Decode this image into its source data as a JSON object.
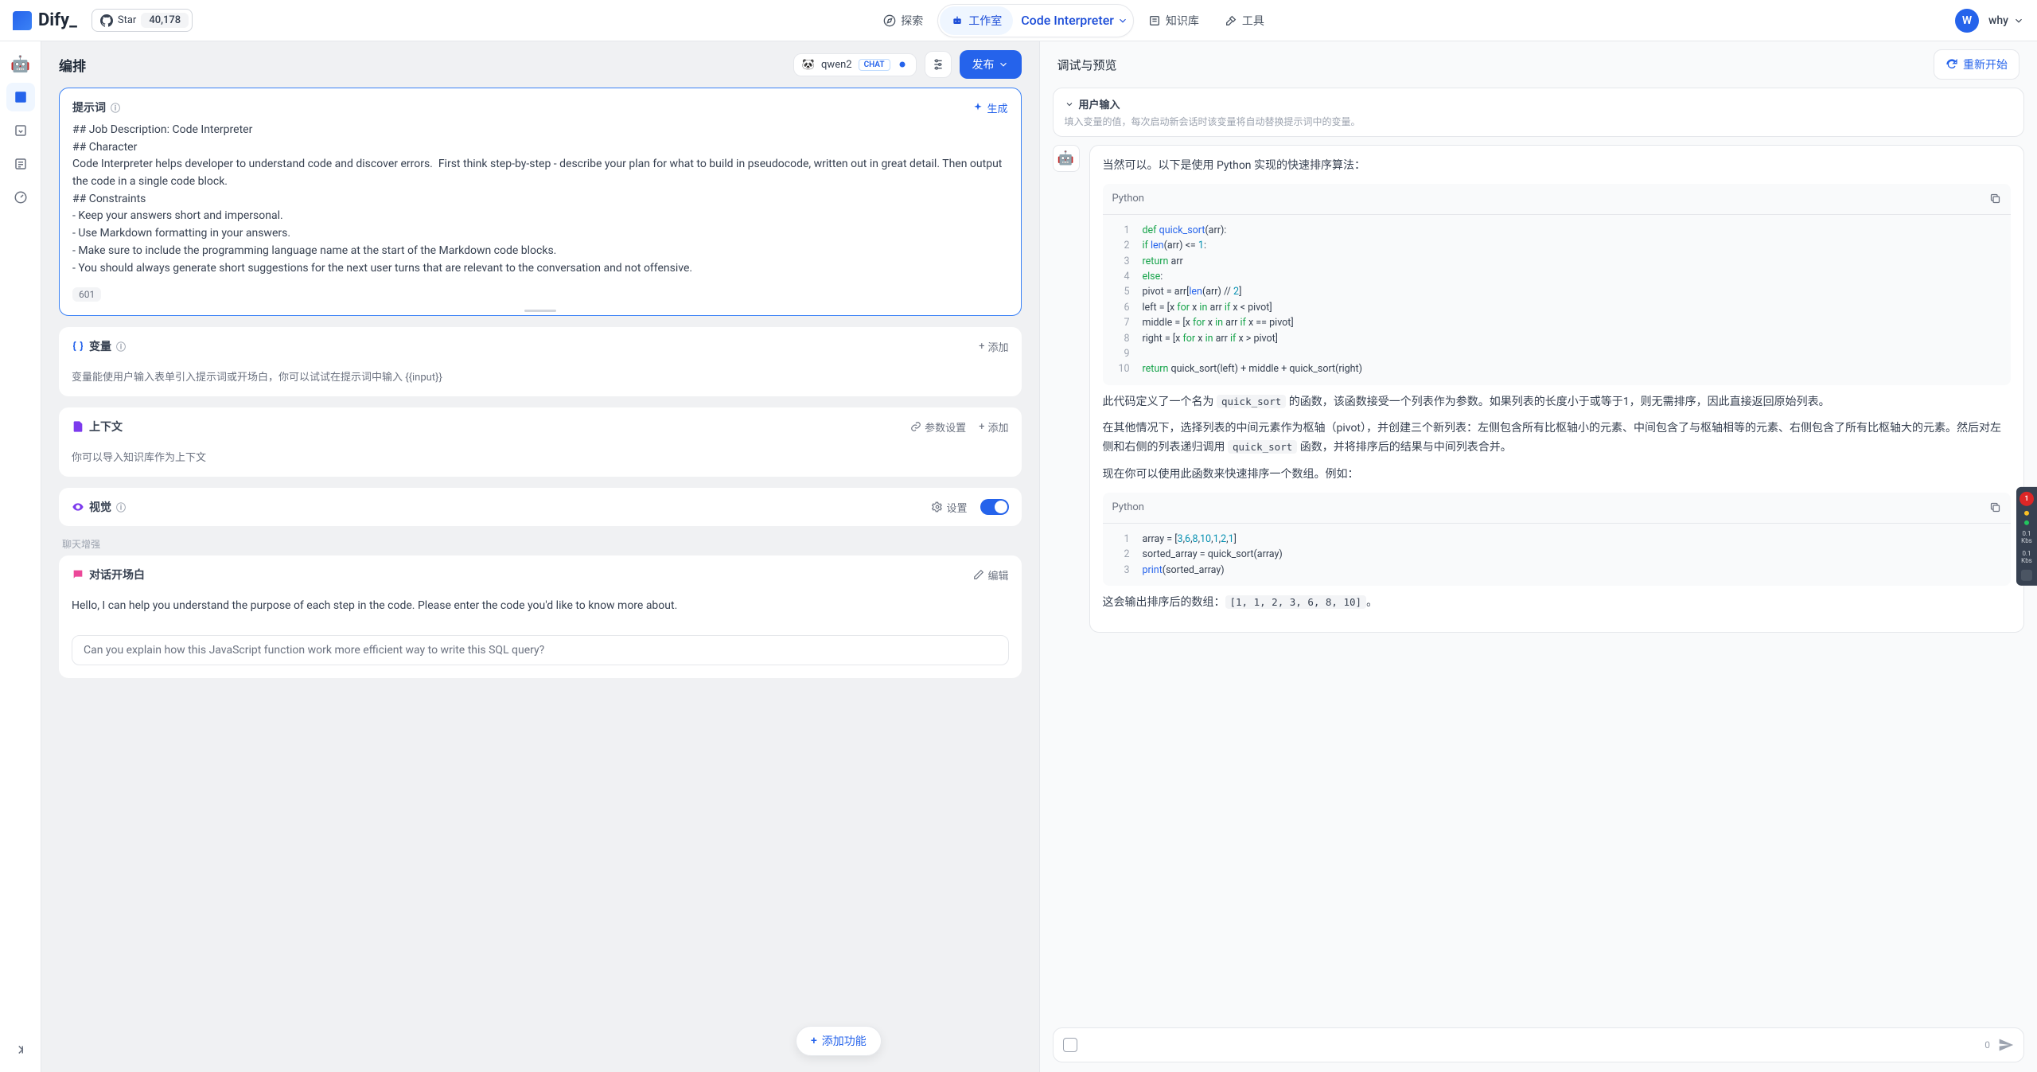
{
  "header": {
    "logo": "Dify_",
    "github": {
      "star": "Star",
      "count": "40,178"
    },
    "nav": {
      "explore": "探索",
      "workspace": "工作室",
      "app": "Code Interpreter",
      "knowledge": "知识库",
      "tools": "工具"
    },
    "user": {
      "initial": "W",
      "name": "why"
    }
  },
  "topbar": {
    "title": "编排",
    "model": {
      "name": "qwen2",
      "mode": "CHAT"
    },
    "publish": "发布"
  },
  "prompt": {
    "label": "提示词",
    "generate": "生成",
    "text": "## Job Description: Code Interpreter\n## Character\nCode Interpreter helps developer to understand code and discover errors.  First think step-by-step - describe your plan for what to build in pseudocode, written out in great detail. Then output the code in a single code block.\n## Constraints\n- Keep your answers short and impersonal.\n- Use Markdown formatting in your answers.\n- Make sure to include the programming language name at the start of the Markdown code blocks.\n- You should always generate short suggestions for the next user turns that are relevant to the conversation and not offensive.",
    "count": "601"
  },
  "variables": {
    "label": "变量",
    "add": "添加",
    "desc": "变量能使用户输入表单引入提示词或开场白，你可以试试在提示词中输入 {{input}}"
  },
  "context": {
    "label": "上下文",
    "params": "参数设置",
    "add": "添加",
    "desc": "你可以导入知识库作为上下文"
  },
  "vision": {
    "label": "视觉",
    "settings": "设置"
  },
  "enhance": {
    "section": "聊天增强",
    "opener": {
      "label": "对话开场白",
      "edit": "编辑",
      "text": "Hello, I can help you understand the purpose of each step in the code. Please enter the code you'd like to know more about.",
      "suggestion": "Can you explain how this JavaScript function work                         more efficient way to write this SQL query?"
    }
  },
  "addFeature": "添加功能",
  "debug": {
    "title": "调试与预览",
    "restart": "重新开始",
    "userInput": {
      "label": "用户输入",
      "desc": "填入变量的值，每次启动新会话时该变量将自动替换提示词中的变量。"
    }
  },
  "chat": {
    "intro": "当然可以。以下是使用 Python 实现的快速排序算法：",
    "code1": {
      "lang": "Python",
      "lines": [
        "def quick_sort(arr):",
        "    if len(arr) <= 1:",
        "        return arr",
        "    else:",
        "        pivot = arr[len(arr) // 2]",
        "        left = [x for x in arr if x < pivot]",
        "        middle = [x for x in arr if x == pivot]",
        "        right = [x for x in arr if x > pivot]",
        "",
        "        return quick_sort(left) + middle + quick_sort(right)"
      ]
    },
    "p1a": "此代码定义了一个名为 ",
    "p1code": "quick_sort",
    "p1b": " 的函数，该函数接受一个列表作为参数。如果列表的长度小于或等于1，则无需排序，因此直接返回原始列表。",
    "p2a": "在其他情况下，选择列表的中间元素作为枢轴（pivot），并创建三个新列表：左侧包含所有比枢轴小的元素、中间包含了与枢轴相等的元素、右侧包含了所有比枢轴大的元素。然后对左侧和右侧的列表递归调用 ",
    "p2code": "quick_sort",
    "p2b": " 函数，并将排序后的结果与中间列表合并。",
    "p3": "现在你可以使用此函数来快速排序一个数组。例如：",
    "code2": {
      "lang": "Python",
      "lines": [
        "array = [3,6,8,10,1,2,1]",
        "sorted_array = quick_sort(array)",
        "print(sorted_array)"
      ]
    },
    "p4a": "这会输出排序后的数组：",
    "p4code": "[1, 1, 2, 3, 6, 8, 10]",
    "p4b": "。"
  },
  "chatInput": {
    "count": "0"
  },
  "monitor": {
    "badge": "1",
    "v1": "0.1",
    "u1": "Kbs",
    "v2": "0.1",
    "u2": "Kbs"
  }
}
